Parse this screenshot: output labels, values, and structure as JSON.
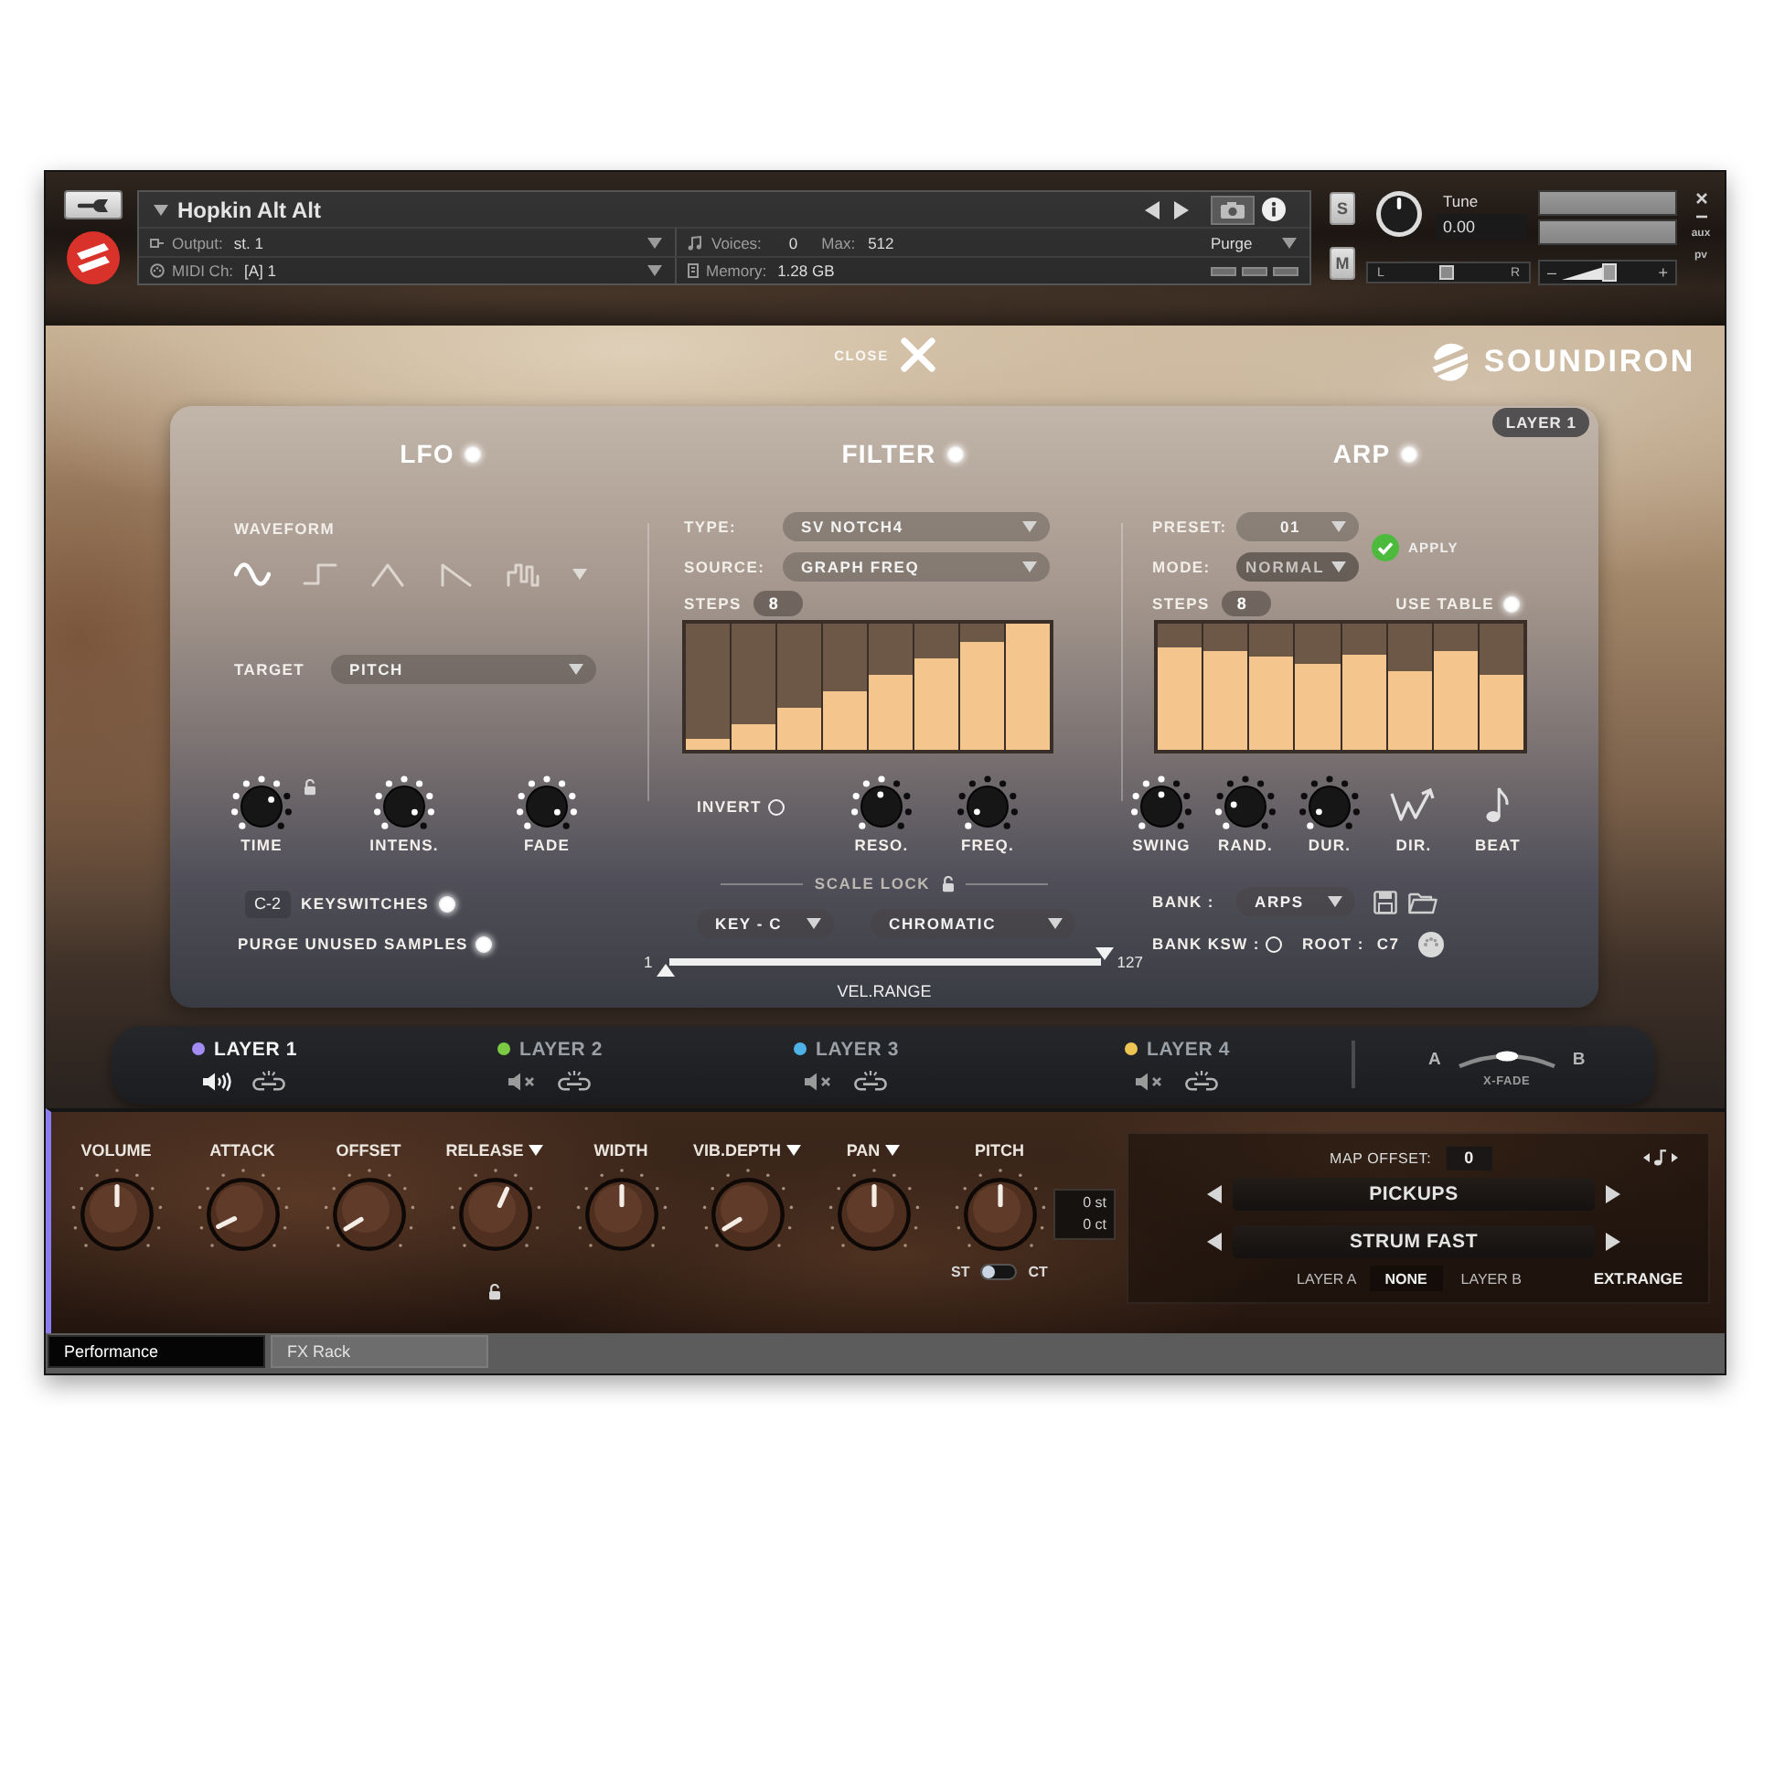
{
  "header": {
    "title": "Hopkin Alt Alt",
    "output": {
      "label": "Output:",
      "value": "st. 1"
    },
    "midi": {
      "label": "MIDI Ch:",
      "value": "[A] 1"
    },
    "voices": {
      "label": "Voices:",
      "value": "0",
      "max_label": "Max:",
      "max_value": "512"
    },
    "memory": {
      "label": "Memory:",
      "value": "1.28 GB"
    },
    "purge": "Purge",
    "solo": "S",
    "mute": "M",
    "tune": {
      "label": "Tune",
      "value": "0.00",
      "level": 0.5
    },
    "pan": {
      "left": "L",
      "right": "R",
      "level": 0.5
    },
    "volume": {
      "minus": "–",
      "plus": "+",
      "level": 0.5
    },
    "side": [
      "aux",
      "pv"
    ]
  },
  "main": {
    "close": "CLOSE",
    "brand": "SOUNDIRON",
    "badge": "LAYER 1"
  },
  "lfo": {
    "title": "LFO",
    "on": true,
    "waveform_label": "WAVEFORM",
    "waveforms": [
      {
        "kind": "sine",
        "selected": true
      },
      {
        "kind": "square",
        "selected": false
      },
      {
        "kind": "triangle",
        "selected": false
      },
      {
        "kind": "saw",
        "selected": false
      },
      {
        "kind": "random",
        "selected": false
      }
    ],
    "target": {
      "label": "TARGET",
      "value": "PITCH"
    },
    "knobs": [
      {
        "label": "TIME",
        "level": 0.7,
        "lock": true
      },
      {
        "label": "INTENS.",
        "level": 0.94,
        "lock": false
      },
      {
        "label": "FADE",
        "level": 0.94,
        "lock": false
      }
    ],
    "keyswitch": {
      "note": "C-2",
      "label": "KEYSWITCHES",
      "on": true
    },
    "purge": {
      "label": "PURGE UNUSED SAMPLES",
      "on": true
    }
  },
  "filter": {
    "title": "FILTER",
    "on": true,
    "type": {
      "label": "TYPE:",
      "value": "SV NOTCH4"
    },
    "source": {
      "label": "SOURCE:",
      "value": "GRAPH FREQ"
    },
    "steps": {
      "label": "STEPS",
      "value": "8"
    },
    "table": [
      {
        "level": 0.08
      },
      {
        "level": 0.2
      },
      {
        "level": 0.33
      },
      {
        "level": 0.46
      },
      {
        "level": 0.59
      },
      {
        "level": 0.72
      },
      {
        "level": 0.85
      },
      {
        "level": 1
      }
    ],
    "invert": {
      "label": "INVERT",
      "on": false
    },
    "knobs": [
      {
        "label": "RESO.",
        "level": 0.48
      },
      {
        "label": "FREQ.",
        "level": 0.07
      }
    ],
    "scale_lock": "SCALE LOCK",
    "key": "KEY - C",
    "scale": "CHROMATIC",
    "velocity": {
      "min": "1",
      "max": "127",
      "label": "VEL.RANGE",
      "handles": [
        {
          "level": 0
        },
        {
          "level": 1
        }
      ]
    }
  },
  "arp": {
    "title": "ARP",
    "on": true,
    "preset": {
      "label": "PRESET:",
      "value": "01"
    },
    "mode": {
      "label": "MODE:",
      "value": "NORMAL",
      "disabled": true
    },
    "apply": "APPLY",
    "steps": {
      "label": "STEPS",
      "value": "8"
    },
    "use_table": {
      "label": "USE TABLE",
      "on": true
    },
    "table": [
      {
        "level": 0.81
      },
      {
        "level": 0.78
      },
      {
        "level": 0.74
      },
      {
        "level": 0.68
      },
      {
        "level": 0.75
      },
      {
        "level": 0.62
      },
      {
        "level": 0.78
      },
      {
        "level": 0.59
      }
    ],
    "knobs": [
      {
        "label": "SWING",
        "level": 0.5
      },
      {
        "label": "RAND.",
        "level": 0.2
      },
      {
        "label": "DUR.",
        "level": 0.07
      }
    ],
    "buttons": [
      {
        "kind": "direction",
        "label": "DIR."
      },
      {
        "kind": "beat",
        "label": "BEAT"
      }
    ],
    "bank": {
      "label": "BANK :",
      "value": "ARPS"
    },
    "bank_ksw": {
      "label": "BANK KSW :",
      "on": false
    },
    "root": {
      "label": "ROOT :",
      "value": "C7"
    }
  },
  "layers": {
    "items": [
      {
        "name": "LAYER 1",
        "color": "#a28cf4",
        "selected": true,
        "muted": false
      },
      {
        "name": "LAYER 2",
        "color": "#7cc944",
        "selected": false,
        "muted": true
      },
      {
        "name": "LAYER 3",
        "color": "#4fb2e6",
        "selected": false,
        "muted": true
      },
      {
        "name": "LAYER 4",
        "color": "#eec555",
        "selected": false,
        "muted": true
      }
    ],
    "xfade": {
      "a": "A",
      "b": "B",
      "label": "X-FADE",
      "level": 0.5
    }
  },
  "performance": {
    "knobs": [
      {
        "label": "VOLUME",
        "level": 0.5,
        "menu": false,
        "lock": false
      },
      {
        "label": "ATTACK",
        "level": 0.07,
        "menu": false,
        "lock": false
      },
      {
        "label": "OFFSET",
        "level": 0.05,
        "menu": false,
        "lock": false
      },
      {
        "label": "RELEASE",
        "level": 0.59,
        "menu": true,
        "lock": true
      },
      {
        "label": "WIDTH",
        "level": 0.5,
        "menu": false,
        "lock": false
      },
      {
        "label": "VIB.DEPTH",
        "level": 0.05,
        "menu": true,
        "lock": false
      },
      {
        "label": "PAN",
        "level": 0.5,
        "menu": true,
        "lock": false
      }
    ],
    "pitch": {
      "label": "PITCH",
      "level": 0.5,
      "display": [
        "0 st",
        "0 ct"
      ],
      "unit": {
        "left": "ST",
        "right": "CT",
        "on": false
      }
    },
    "map_offset": {
      "label": "MAP OFFSET:",
      "value": "0"
    },
    "selectors": [
      "PICKUPS",
      "STRUM FAST"
    ],
    "layer_a": "LAYER A",
    "layer_select": "NONE",
    "layer_b": "LAYER B",
    "ext_range": "EXT.RANGE"
  },
  "tabs": [
    {
      "label": "Performance",
      "selected": true
    },
    {
      "label": "FX Rack",
      "selected": false
    }
  ]
}
